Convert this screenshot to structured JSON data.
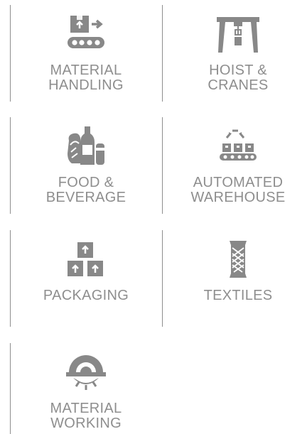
{
  "industries": [
    {
      "label_line1": "MATERIAL",
      "label_line2": "HANDLING",
      "icon": "conveyor-box-icon"
    },
    {
      "label_line1": "HOIST &",
      "label_line2": "CRANES",
      "icon": "gantry-crane-icon"
    },
    {
      "label_line1": "FOOD &",
      "label_line2": "BEVERAGE",
      "icon": "food-beverage-icon"
    },
    {
      "label_line1": "AUTOMATED",
      "label_line2": "WAREHOUSE",
      "icon": "automated-warehouse-icon"
    },
    {
      "label_line1": "PACKAGING",
      "label_line2": "",
      "icon": "stacked-boxes-icon"
    },
    {
      "label_line1": "TEXTILES",
      "label_line2": "",
      "icon": "thread-spool-icon"
    },
    {
      "label_line1": "MATERIAL",
      "label_line2": "WORKING",
      "icon": "saw-blade-icon"
    }
  ],
  "colors": {
    "icon": "#888888",
    "text": "#8e8e8e",
    "divider": "#8e8e8e",
    "background": "#ffffff"
  }
}
